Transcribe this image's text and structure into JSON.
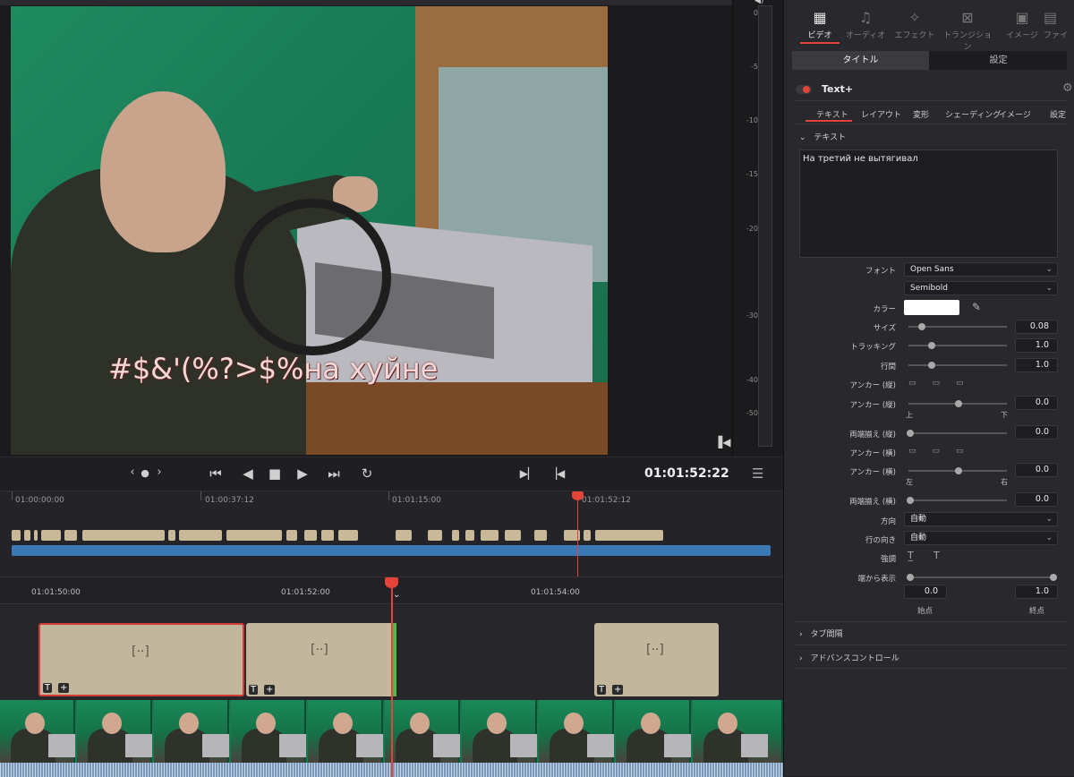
{
  "viewer": {
    "subtitle": "#$&'(%?>$%на хуйне",
    "timecode": "01:01:52:22"
  },
  "meter": {
    "labels": [
      "0",
      "-5",
      "-10",
      "-15",
      "-20",
      "-30",
      "-40",
      "-50"
    ]
  },
  "overview_ruler": [
    "01:00:00:00",
    "01:00:37:12",
    "01:01:15:00",
    "01:01:52:12"
  ],
  "timeline_ruler": [
    "01:01:50:00",
    "01:01:52:00",
    "01:01:54:00"
  ],
  "clip_tags": {
    "title": "T",
    "transform": "+"
  },
  "clip_glyph": "[··]",
  "inspector": {
    "tabs": [
      {
        "label": "ビデオ",
        "icon": "film-icon"
      },
      {
        "label": "オーディオ",
        "icon": "music-icon"
      },
      {
        "label": "エフェクト",
        "icon": "wand-icon"
      },
      {
        "label": "トランジション",
        "icon": "transition-icon"
      },
      {
        "label": "イメージ",
        "icon": "image-icon"
      },
      {
        "label": "ファイ",
        "icon": "file-icon"
      }
    ],
    "subtabs": [
      "タイトル",
      "設定"
    ],
    "effect_name": "Text+",
    "control_tabs": [
      "テキスト",
      "レイアウト",
      "変形",
      "シェーディング",
      "イメージ",
      "設定"
    ],
    "section_text": "テキスト",
    "text_value": "На третий не вытягивал",
    "labels": {
      "font": "フォント",
      "color": "カラー",
      "size": "サイズ",
      "tracking": "トラッキング",
      "line_spacing": "行間",
      "anchor_v": "アンカー (縦)",
      "anchor_v2": "アンカー (縦)",
      "justify_v": "両端揃え (縦)",
      "anchor_h": "アンカー (横)",
      "anchor_h2": "アンカー (横)",
      "justify_h": "両端揃え (横)",
      "direction": "方向",
      "line_direction": "行の向き",
      "emphasis": "強調",
      "write_on": "端から表示",
      "top": "上",
      "bottom": "下",
      "left": "左",
      "right": "右",
      "start": "始点",
      "end": "終点"
    },
    "font_family": "Open Sans",
    "font_style": "Semibold",
    "color_value": "#ffffff",
    "values": {
      "size": "0.08",
      "tracking": "1.0",
      "line_spacing": "1.0",
      "anchor_v": "0.0",
      "justify_v": "0.0",
      "anchor_h": "0.0",
      "justify_h": "0.0",
      "write_on_start": "0.0",
      "write_on_end": "1.0"
    },
    "direction": "自動",
    "line_direction": "自動",
    "collapsed_sections": [
      "タブ間隔",
      "アドバンスコントロール"
    ]
  }
}
